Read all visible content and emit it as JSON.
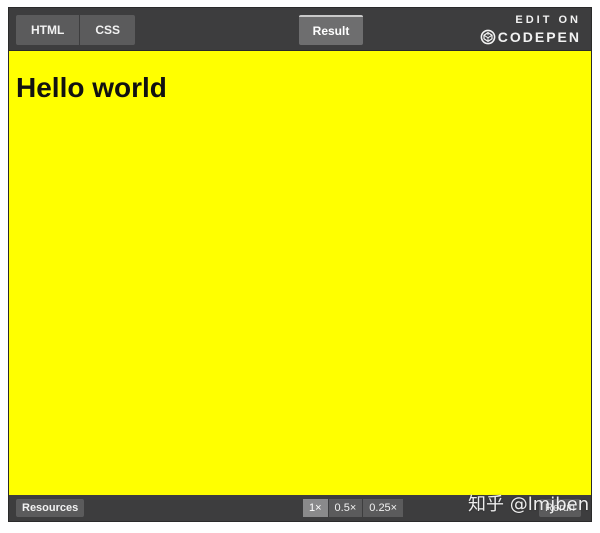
{
  "tabs": {
    "html_label": "HTML",
    "css_label": "CSS",
    "result_label": "Result"
  },
  "edit_on": {
    "line1": "EDIT ON",
    "brand": "CODEPEN"
  },
  "result": {
    "heading": "Hello world",
    "background_color": "#ffff00"
  },
  "bottom": {
    "resources_label": "Resources",
    "zoom_options": [
      "1×",
      "0.5×",
      "0.25×"
    ],
    "zoom_selected": "1×",
    "rerun_label": "Rerun"
  },
  "watermark": {
    "text": "知乎 @lmjben"
  },
  "icons": {
    "codepen_logo": "codepen-logo-icon"
  }
}
